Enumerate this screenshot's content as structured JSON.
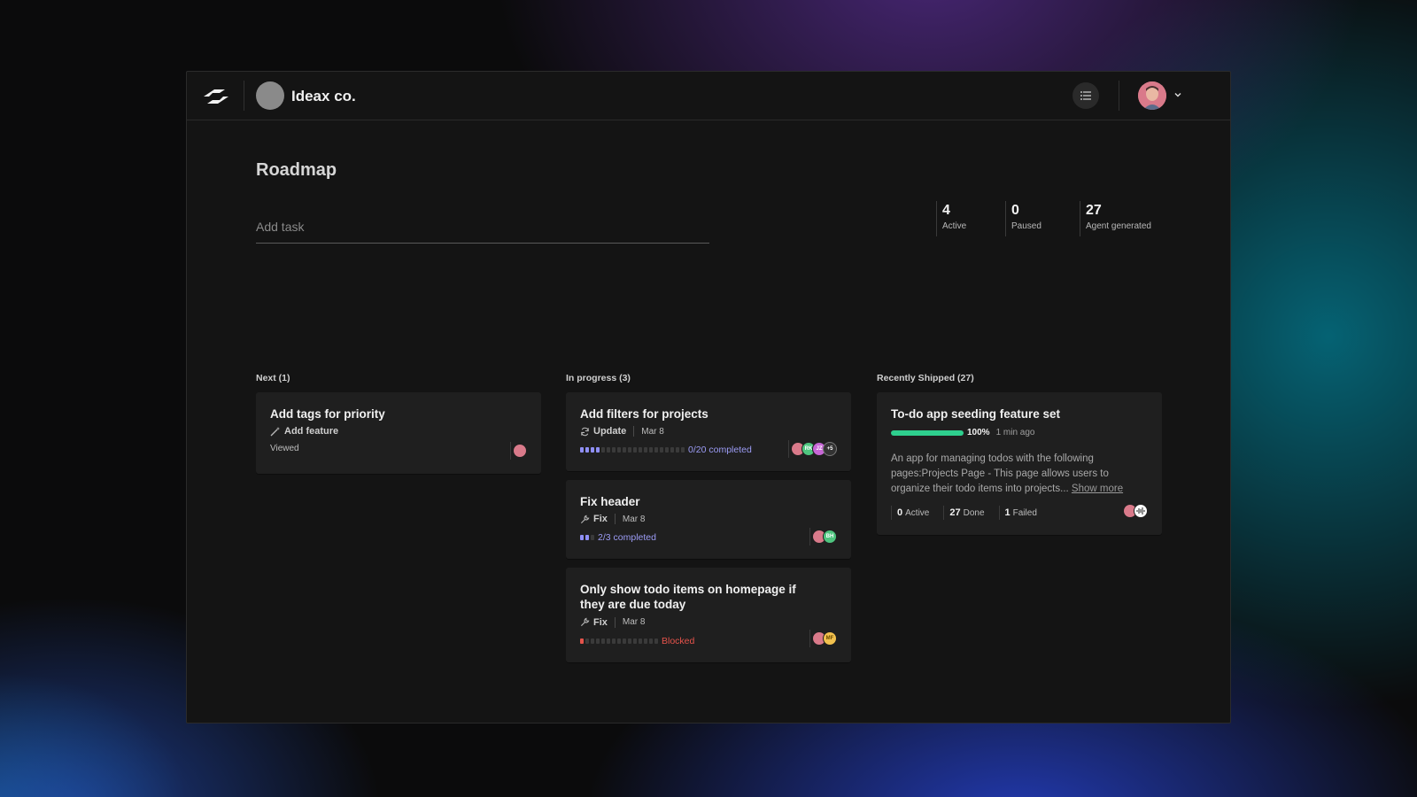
{
  "header": {
    "org_name": "Ideax co.",
    "logo_icon": "app-logo-icon",
    "list_icon": "list-icon",
    "user_avatar_icon": "user-avatar",
    "menu_icon": "chevron-down-icon"
  },
  "page": {
    "title": "Roadmap",
    "add_task_placeholder": "Add task"
  },
  "stats": [
    {
      "value": "4",
      "label": "Active"
    },
    {
      "value": "0",
      "label": "Paused"
    },
    {
      "value": "27",
      "label": "Agent generated"
    }
  ],
  "columns": {
    "next": {
      "title": "Next (1)",
      "cards": [
        {
          "title": "Add tags for priority",
          "type": "Add feature",
          "type_icon": "magic-wand-icon",
          "status": "Viewed"
        }
      ]
    },
    "in_progress": {
      "title": "In progress (3)",
      "cards": [
        {
          "title": "Add filters for projects",
          "type": "Update",
          "type_icon": "refresh-icon",
          "date": "Mar 8",
          "progress_text": "0/20 completed",
          "progress_done": 0,
          "progress_total": 20,
          "avatars": [
            "",
            "RK",
            "JZ",
            "+5"
          ]
        },
        {
          "title": "Fix header",
          "type": "Fix",
          "type_icon": "wrench-icon",
          "date": "Mar 8",
          "progress_text": "2/3 completed",
          "progress_done": 2,
          "progress_total": 3,
          "avatars": [
            "",
            "BH"
          ]
        },
        {
          "title": "Only show todo items on homepage if they are due today",
          "type": "Fix",
          "type_icon": "wrench-icon",
          "date": "Mar 8",
          "progress_text": "Blocked",
          "avatars": [
            "",
            "MF"
          ]
        }
      ]
    },
    "shipped": {
      "title": "Recently Shipped (27)",
      "cards": [
        {
          "title": "To-do app seeding feature set",
          "progress": 1.0,
          "progress_text": "100%",
          "time": "1 min ago",
          "description": "An app for managing todos with the following pages:Projects Page - This page allows users to organize their todo items into projects...",
          "show_more": "Show more",
          "stats": [
            {
              "value": "0",
              "label": "Active"
            },
            {
              "value": "27",
              "label": "Done"
            },
            {
              "value": "1",
              "label": "Failed"
            }
          ]
        }
      ]
    }
  },
  "colors": {
    "accent": "#8f8ff5",
    "success": "#2ecf8e",
    "danger": "#e5534b"
  }
}
